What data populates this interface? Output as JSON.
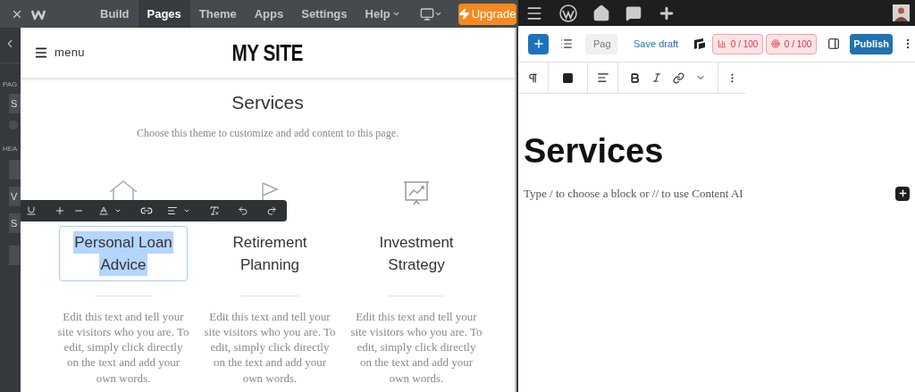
{
  "builder": {
    "tabs": [
      {
        "label": "Build",
        "selected": false,
        "kind": "tab"
      },
      {
        "label": "Pages",
        "selected": true,
        "kind": "tab"
      },
      {
        "label": "Theme",
        "selected": false,
        "kind": "tab"
      },
      {
        "label": "Apps",
        "selected": false,
        "kind": "tab"
      },
      {
        "label": "Settings",
        "selected": false,
        "kind": "tab"
      },
      {
        "label": "Help",
        "selected": false,
        "kind": "dropdown"
      }
    ],
    "upgrade": "Upgrade",
    "sidebar": {
      "section_labels": [
        "PAG",
        "HEA"
      ],
      "fields": [
        {
          "label": "S",
          "kind": "field"
        },
        {
          "kind": "toggle"
        },
        {
          "kind": "field"
        },
        {
          "label": "V",
          "kind": "field"
        },
        {
          "label": "S",
          "kind": "field"
        },
        {
          "kind": "button"
        }
      ]
    },
    "site": {
      "menu": "menu",
      "title": "MY SITE",
      "heading": "Services",
      "subtitle": "Choose this theme to customize and add content to this page.",
      "columns": [
        {
          "kind": "house",
          "title_lines": [
            "Personal Loan",
            "Advice"
          ],
          "selected": true,
          "body": "Edit this text and tell your site visitors who you are. To edit, simply click directly on the text and add your own words."
        },
        {
          "kind": "flag",
          "title_lines": [
            "Retirement",
            "Planning"
          ],
          "selected": false,
          "body": "Edit this text and tell your site visitors who you are. To edit, simply click directly on the text and add your own words."
        },
        {
          "kind": "presentation",
          "title_lines": [
            "Investment",
            "Strategy"
          ],
          "selected": false,
          "body": "Edit this text and tell your site visitors who you are. To edit, simply click directly on the text and add your own words."
        }
      ]
    }
  },
  "wordpress": {
    "page_field": "Pag",
    "save_draft": "Save draft",
    "scores": [
      {
        "kind": "seo",
        "text": "0 / 100"
      },
      {
        "kind": "readability",
        "text": "0 / 100"
      }
    ],
    "publish": "Publish",
    "title": "Services",
    "placeholder": "Type / to choose a block or // to use Content AI"
  }
}
